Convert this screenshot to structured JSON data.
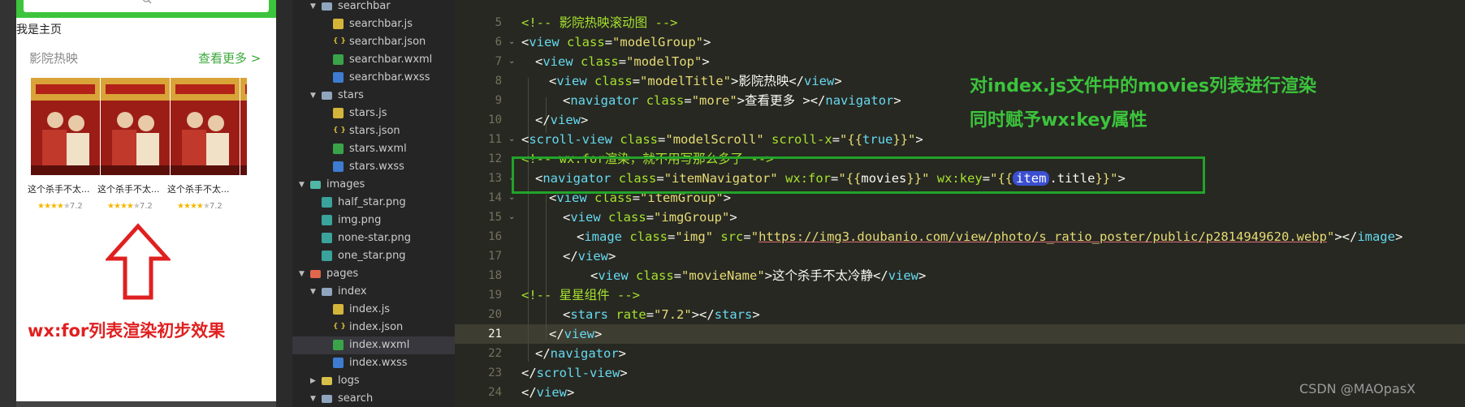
{
  "preview": {
    "home_text": "我是主页",
    "section_title": "影院热映",
    "more_link": "查看更多 >",
    "movies": [
      {
        "name": "这个杀手不太...",
        "rating": "7.2"
      },
      {
        "name": "这个杀手不太...",
        "rating": "7.2"
      },
      {
        "name": "这个杀手不太...",
        "rating": "7.2"
      }
    ],
    "effect_caption": "wx:for列表渲染初步效果"
  },
  "file_tree": [
    {
      "label": "searchbar",
      "type": "folder",
      "expanded": true,
      "depth": 1
    },
    {
      "label": "searchbar.js",
      "type": "js",
      "depth": 2
    },
    {
      "label": "searchbar.json",
      "type": "json",
      "depth": 2
    },
    {
      "label": "searchbar.wxml",
      "type": "wxml",
      "depth": 2
    },
    {
      "label": "searchbar.wxss",
      "type": "wxss",
      "depth": 2
    },
    {
      "label": "stars",
      "type": "folder",
      "expanded": true,
      "depth": 1
    },
    {
      "label": "stars.js",
      "type": "js",
      "depth": 2
    },
    {
      "label": "stars.json",
      "type": "json",
      "depth": 2
    },
    {
      "label": "stars.wxml",
      "type": "wxml",
      "depth": 2
    },
    {
      "label": "stars.wxss",
      "type": "wxss",
      "depth": 2
    },
    {
      "label": "images",
      "type": "folder-img",
      "expanded": true,
      "depth": 0
    },
    {
      "label": "half_star.png",
      "type": "png",
      "depth": 1
    },
    {
      "label": "img.png",
      "type": "png",
      "depth": 1
    },
    {
      "label": "none-star.png",
      "type": "png",
      "depth": 1
    },
    {
      "label": "one_star.png",
      "type": "png",
      "depth": 1
    },
    {
      "label": "pages",
      "type": "folder-pages",
      "expanded": true,
      "depth": 0
    },
    {
      "label": "index",
      "type": "folder",
      "expanded": true,
      "depth": 1
    },
    {
      "label": "index.js",
      "type": "js",
      "depth": 2
    },
    {
      "label": "index.json",
      "type": "json",
      "depth": 2
    },
    {
      "label": "index.wxml",
      "type": "wxml",
      "depth": 2,
      "selected": true
    },
    {
      "label": "index.wxss",
      "type": "wxss",
      "depth": 2
    },
    {
      "label": "logs",
      "type": "folder-logs",
      "expanded": false,
      "depth": 1
    },
    {
      "label": "search",
      "type": "folder",
      "expanded": true,
      "depth": 1
    }
  ],
  "editor": {
    "active_line": "21",
    "lines": [
      {
        "n": "5",
        "fold": "",
        "indent": 0,
        "tokens": [
          [
            "cm",
            "<!-- 影院热映滚动图 -->"
          ]
        ]
      },
      {
        "n": "6",
        "fold": "v",
        "indent": 0,
        "tokens": [
          [
            "pun",
            "<"
          ],
          [
            "tag",
            "view"
          ],
          [
            "pun",
            " "
          ],
          [
            "attr",
            "class"
          ],
          [
            "pun",
            "="
          ],
          [
            "str",
            "\"modelGroup\""
          ],
          [
            "pun",
            ">"
          ]
        ]
      },
      {
        "n": "7",
        "fold": "v",
        "indent": 1,
        "tokens": [
          [
            "pun",
            "<"
          ],
          [
            "tag",
            "view"
          ],
          [
            "pun",
            " "
          ],
          [
            "attr",
            "class"
          ],
          [
            "pun",
            "="
          ],
          [
            "str",
            "\"modelTop\""
          ],
          [
            "pun",
            ">"
          ]
        ]
      },
      {
        "n": "8",
        "fold": "",
        "indent": 2,
        "tokens": [
          [
            "pun",
            "<"
          ],
          [
            "tag",
            "view"
          ],
          [
            "pun",
            " "
          ],
          [
            "attr",
            "class"
          ],
          [
            "pun",
            "="
          ],
          [
            "str",
            "\"modelTitle\""
          ],
          [
            "pun",
            ">影院热映</"
          ],
          [
            "tag",
            "view"
          ],
          [
            "pun",
            ">"
          ]
        ]
      },
      {
        "n": "9",
        "fold": "",
        "indent": 3,
        "tokens": [
          [
            "pun",
            "<"
          ],
          [
            "tag",
            "navigator"
          ],
          [
            "pun",
            " "
          ],
          [
            "attr",
            "class"
          ],
          [
            "pun",
            "="
          ],
          [
            "str",
            "\"more\""
          ],
          [
            "pun",
            ">查看更多 ></"
          ],
          [
            "tag",
            "navigator"
          ],
          [
            "pun",
            ">"
          ]
        ]
      },
      {
        "n": "10",
        "fold": "",
        "indent": 1,
        "tokens": [
          [
            "pun",
            "</"
          ],
          [
            "tag",
            "view"
          ],
          [
            "pun",
            ">"
          ]
        ]
      },
      {
        "n": "11",
        "fold": "v",
        "indent": 0,
        "tokens": [
          [
            "pun",
            "<"
          ],
          [
            "tag",
            "scroll-view"
          ],
          [
            "pun",
            " "
          ],
          [
            "attr",
            "class"
          ],
          [
            "pun",
            "="
          ],
          [
            "str",
            "\"modelScroll\""
          ],
          [
            "pun",
            " "
          ],
          [
            "attr",
            "scroll-x"
          ],
          [
            "pun",
            "="
          ],
          [
            "str",
            "\""
          ],
          [
            "brace",
            "{{"
          ],
          [
            "tag",
            "true"
          ],
          [
            "brace",
            "}}"
          ],
          [
            "str",
            "\""
          ],
          [
            "pun",
            ">"
          ]
        ]
      },
      {
        "n": "12",
        "fold": "",
        "indent": 0,
        "tokens": [
          [
            "cm",
            "<!-- wx:for渲染，就不用写那么多了 -->"
          ]
        ]
      },
      {
        "n": "13",
        "fold": "v",
        "indent": 1,
        "tokens": [
          [
            "pun",
            "<"
          ],
          [
            "tag",
            "navigator"
          ],
          [
            "pun",
            " "
          ],
          [
            "attr",
            "class"
          ],
          [
            "pun",
            "="
          ],
          [
            "str",
            "\"itemNavigator\""
          ],
          [
            "pun",
            " "
          ],
          [
            "attr",
            "wx:for"
          ],
          [
            "pun",
            "="
          ],
          [
            "str",
            "\""
          ],
          [
            "brace",
            "{{"
          ],
          [
            "pun",
            "movies"
          ],
          [
            "brace",
            "}}"
          ],
          [
            "str",
            "\""
          ],
          [
            "pun",
            " "
          ],
          [
            "attr",
            "wx:key"
          ],
          [
            "pun",
            "="
          ],
          [
            "str",
            "\""
          ],
          [
            "brace",
            "{{"
          ],
          [
            "hl",
            "item"
          ],
          [
            "pun",
            ".title"
          ],
          [
            "brace",
            "}}"
          ],
          [
            "str",
            "\""
          ],
          [
            "pun",
            ">"
          ]
        ]
      },
      {
        "n": "14",
        "fold": "v",
        "indent": 2,
        "tokens": [
          [
            "pun",
            "<"
          ],
          [
            "tag",
            "view"
          ],
          [
            "pun",
            " "
          ],
          [
            "attr",
            "class"
          ],
          [
            "pun",
            "="
          ],
          [
            "str",
            "\"itemGroup\""
          ],
          [
            "pun",
            ">"
          ]
        ]
      },
      {
        "n": "15",
        "fold": "v",
        "indent": 3,
        "tokens": [
          [
            "pun",
            "<"
          ],
          [
            "tag",
            "view"
          ],
          [
            "pun",
            " "
          ],
          [
            "attr",
            "class"
          ],
          [
            "pun",
            "="
          ],
          [
            "str",
            "\"imgGroup\""
          ],
          [
            "pun",
            ">"
          ]
        ]
      },
      {
        "n": "16",
        "fold": "",
        "indent": 4,
        "tokens": [
          [
            "pun",
            "<"
          ],
          [
            "tag",
            "image"
          ],
          [
            "pun",
            " "
          ],
          [
            "attr",
            "class"
          ],
          [
            "pun",
            "="
          ],
          [
            "str",
            "\"img\""
          ],
          [
            "pun",
            " "
          ],
          [
            "attr",
            "src"
          ],
          [
            "pun",
            "="
          ],
          [
            "str",
            "\""
          ],
          [
            "url",
            "https://img3.doubanio.com/view/photo/s_ratio_poster/public/p2814949620.webp"
          ],
          [
            "str",
            "\""
          ],
          [
            "pun",
            "></"
          ],
          [
            "tag",
            "image"
          ],
          [
            "pun",
            ">"
          ]
        ]
      },
      {
        "n": "17",
        "fold": "",
        "indent": 3,
        "tokens": [
          [
            "pun",
            "</"
          ],
          [
            "tag",
            "view"
          ],
          [
            "pun",
            ">"
          ]
        ]
      },
      {
        "n": "18",
        "fold": "",
        "indent": 5,
        "tokens": [
          [
            "pun",
            "<"
          ],
          [
            "tag",
            "view"
          ],
          [
            "pun",
            " "
          ],
          [
            "attr",
            "class"
          ],
          [
            "pun",
            "="
          ],
          [
            "str",
            "\"movieName\""
          ],
          [
            "pun",
            ">这个杀手不太冷静</"
          ],
          [
            "tag",
            "view"
          ],
          [
            "pun",
            ">"
          ]
        ]
      },
      {
        "n": "19",
        "fold": "",
        "indent": 0,
        "tokens": [
          [
            "cm",
            "<!-- 星星组件 -->"
          ]
        ]
      },
      {
        "n": "20",
        "fold": "",
        "indent": 3,
        "tokens": [
          [
            "pun",
            "<"
          ],
          [
            "tag",
            "stars"
          ],
          [
            "pun",
            " "
          ],
          [
            "attr",
            "rate"
          ],
          [
            "pun",
            "="
          ],
          [
            "str",
            "\"7.2\""
          ],
          [
            "pun",
            "></"
          ],
          [
            "tag",
            "stars"
          ],
          [
            "pun",
            ">"
          ]
        ]
      },
      {
        "n": "21",
        "fold": "",
        "indent": 2,
        "tokens": [
          [
            "pun",
            "</"
          ],
          [
            "tag",
            "view"
          ],
          [
            "pun",
            ">"
          ]
        ]
      },
      {
        "n": "22",
        "fold": "",
        "indent": 1,
        "tokens": [
          [
            "pun",
            "</"
          ],
          [
            "tag",
            "navigator"
          ],
          [
            "pun",
            ">"
          ]
        ]
      },
      {
        "n": "23",
        "fold": "",
        "indent": 0,
        "tokens": [
          [
            "pun",
            "</"
          ],
          [
            "tag",
            "scroll-view"
          ],
          [
            "pun",
            ">"
          ]
        ]
      },
      {
        "n": "24",
        "fold": "",
        "indent": 0,
        "tokens": [
          [
            "pun",
            "</"
          ],
          [
            "tag",
            "view"
          ],
          [
            "pun",
            ">"
          ]
        ]
      }
    ]
  },
  "annotations": {
    "note1": "对index.js文件中的movies列表进行渲染",
    "note2": "同时赋予wx:key属性"
  },
  "watermark": "CSDN @MAOpasX",
  "colors": {
    "accent_green": "#3cc43c",
    "caption_red": "#e02020",
    "editor_bg": "#272822"
  }
}
